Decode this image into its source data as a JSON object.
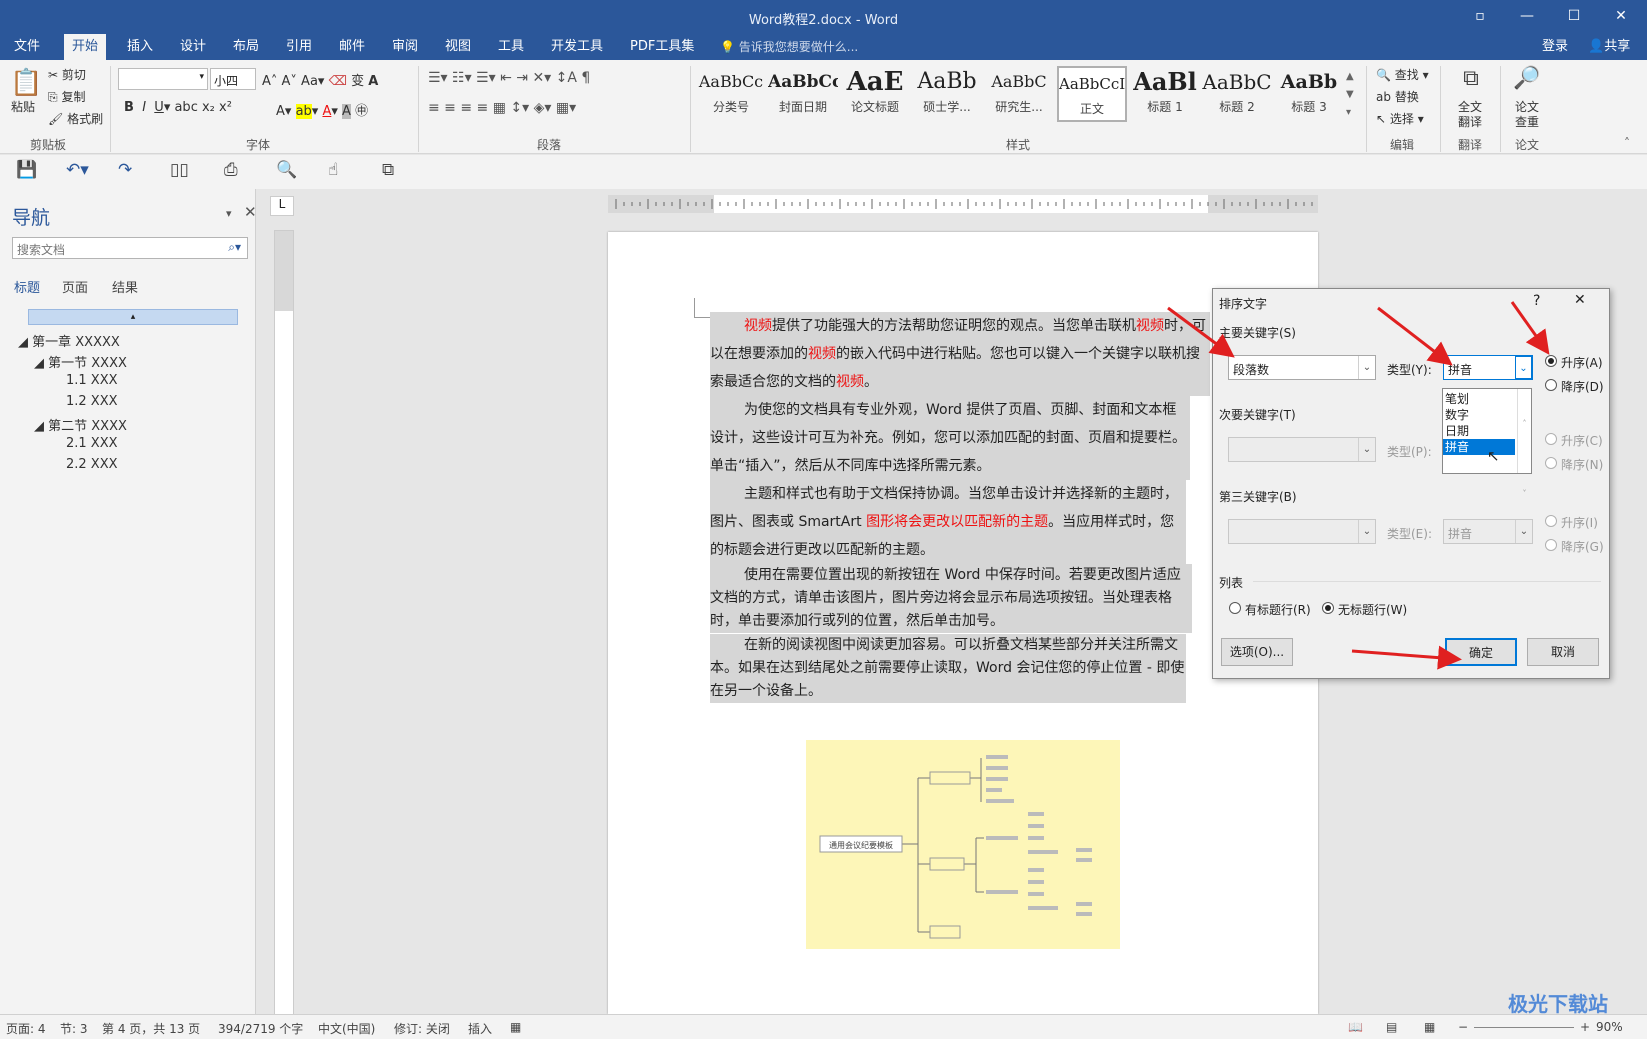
{
  "window": {
    "title": "Word教程2.docx - Word"
  },
  "menu": {
    "items": [
      "文件",
      "开始",
      "插入",
      "设计",
      "布局",
      "引用",
      "邮件",
      "审阅",
      "视图",
      "工具",
      "开发工具",
      "PDF工具集"
    ],
    "tell_me": "告诉我您想要做什么...",
    "login": "登录",
    "share": "共享"
  },
  "ribbon": {
    "clipboard": {
      "paste": "粘贴",
      "cut": "剪切",
      "copy": "复制",
      "format_painter": "格式刷",
      "label": "剪贴板"
    },
    "font": {
      "font_name": "",
      "font_size": "小四",
      "label": "字体"
    },
    "paragraph": {
      "label": "段落"
    },
    "styles": {
      "label": "样式",
      "items": [
        {
          "preview": "AaBbCc",
          "name": "分类号"
        },
        {
          "preview": "AaBbCc",
          "name": "封面日期"
        },
        {
          "preview": "AaE",
          "name": "论文标题"
        },
        {
          "preview": "AaBb",
          "name": "硕士学..."
        },
        {
          "preview": "AaBbC",
          "name": "研究生..."
        },
        {
          "preview": "AaBbCcI",
          "name": "正文"
        },
        {
          "preview": "AaBl",
          "name": "标题 1"
        },
        {
          "preview": "AaBbC",
          "name": "标题 2"
        },
        {
          "preview": "AaBb",
          "name": "标题 3"
        }
      ]
    },
    "editing": {
      "find": "查找",
      "replace": "替换",
      "select": "选择",
      "label": "编辑"
    },
    "translate": {
      "full": "全文",
      "translate": "翻译",
      "label": "翻译"
    },
    "paper": {
      "check": "论文",
      "recheck": "查重",
      "label": "论文"
    }
  },
  "nav": {
    "title": "导航",
    "search_placeholder": "搜索文档",
    "tabs": [
      "标题",
      "页面",
      "结果"
    ],
    "tree": [
      "第一章 XXXXX",
      "第一节 XXXX",
      "1.1 XXX",
      "1.2 XXX",
      "第二节 XXXX",
      "2.1 XXX",
      "2.2 XXX"
    ]
  },
  "doc": {
    "p1": [
      "视频",
      "提供了功能强大的方法帮助您证明您的观点。当您单击联机",
      "视频",
      "时，可以在想要添加的",
      "视频",
      "的嵌入代码中进行粘贴。您也可以键入一个关键字以联机搜索最适合您的文档的",
      "视频",
      "。"
    ],
    "p2": "为使您的文档具有专业外观，Word 提供了页眉、页脚、封面和文本框设计，这些设计可互为补充。例如，您可以添加匹配的封面、页眉和提要栏。单击“插入”，然后从不同库中选择所需元素。",
    "p3": [
      "主题和样式也有助于文档保持协调。当您单击设计并选择新的主题时，图片、图表或 SmartArt ",
      "图形将会更改以匹配新的主题",
      "。当应用样式时，您的标题会进行更改以匹配新的主题。"
    ],
    "p4": "使用在需要位置出现的新按钮在 Word 中保存时间。若要更改图片适应文档的方式，请单击该图片，图片旁边将会显示布局选项按钮。当处理表格时，单击要添加行或列的位置，然后单击加号。",
    "p5": "在新的阅读视图中阅读更加容易。可以折叠文档某些部分并关注所需文本。如果在达到结尾处之前需要停止读取，Word 会记住您的停止位置 - 即使在另一个设备上。",
    "mindmap": {
      "root": "通用会议纪要模板"
    }
  },
  "dialog": {
    "title": "排序文字",
    "help": "?",
    "close": "✕",
    "primary_key_label": "主要关键字(S)",
    "primary_key_value": "段落数",
    "type_label": "类型(Y):",
    "type_value": "拼音",
    "asc": "升序(A)",
    "desc": "降序(D)",
    "secondary_key_label": "次要关键字(T)",
    "type_p_label": "类型(P):",
    "asc2": "升序(C)",
    "desc2": "降序(N)",
    "third_key_label": "第三关键字(B)",
    "type_e_label": "类型(E):",
    "type_e_value": "拼音",
    "asc3": "升序(I)",
    "desc3": "降序(G)",
    "list_label": "列表",
    "header_row": "有标题行(R)",
    "no_header_row": "无标题行(W)",
    "options_button": "选项(O)...",
    "ok_button": "确定",
    "cancel_button": "取消",
    "type_options": [
      "笔划",
      "数字",
      "日期",
      "拼音"
    ],
    "type_selected": "拼音"
  },
  "status": {
    "page": "页面: 4",
    "section": "节: 3",
    "pages": "第 4 页，共 13 页",
    "words": "394/2719 个字",
    "lang": "中文(中国)",
    "track": "修订: 关闭",
    "insert": "插入",
    "zoom": "90%"
  },
  "watermark": "极光下载站",
  "colors": {
    "brand": "#2b579a",
    "accent": "#0078d7",
    "red_text": "#ee1111",
    "arrow": "#e02020"
  }
}
